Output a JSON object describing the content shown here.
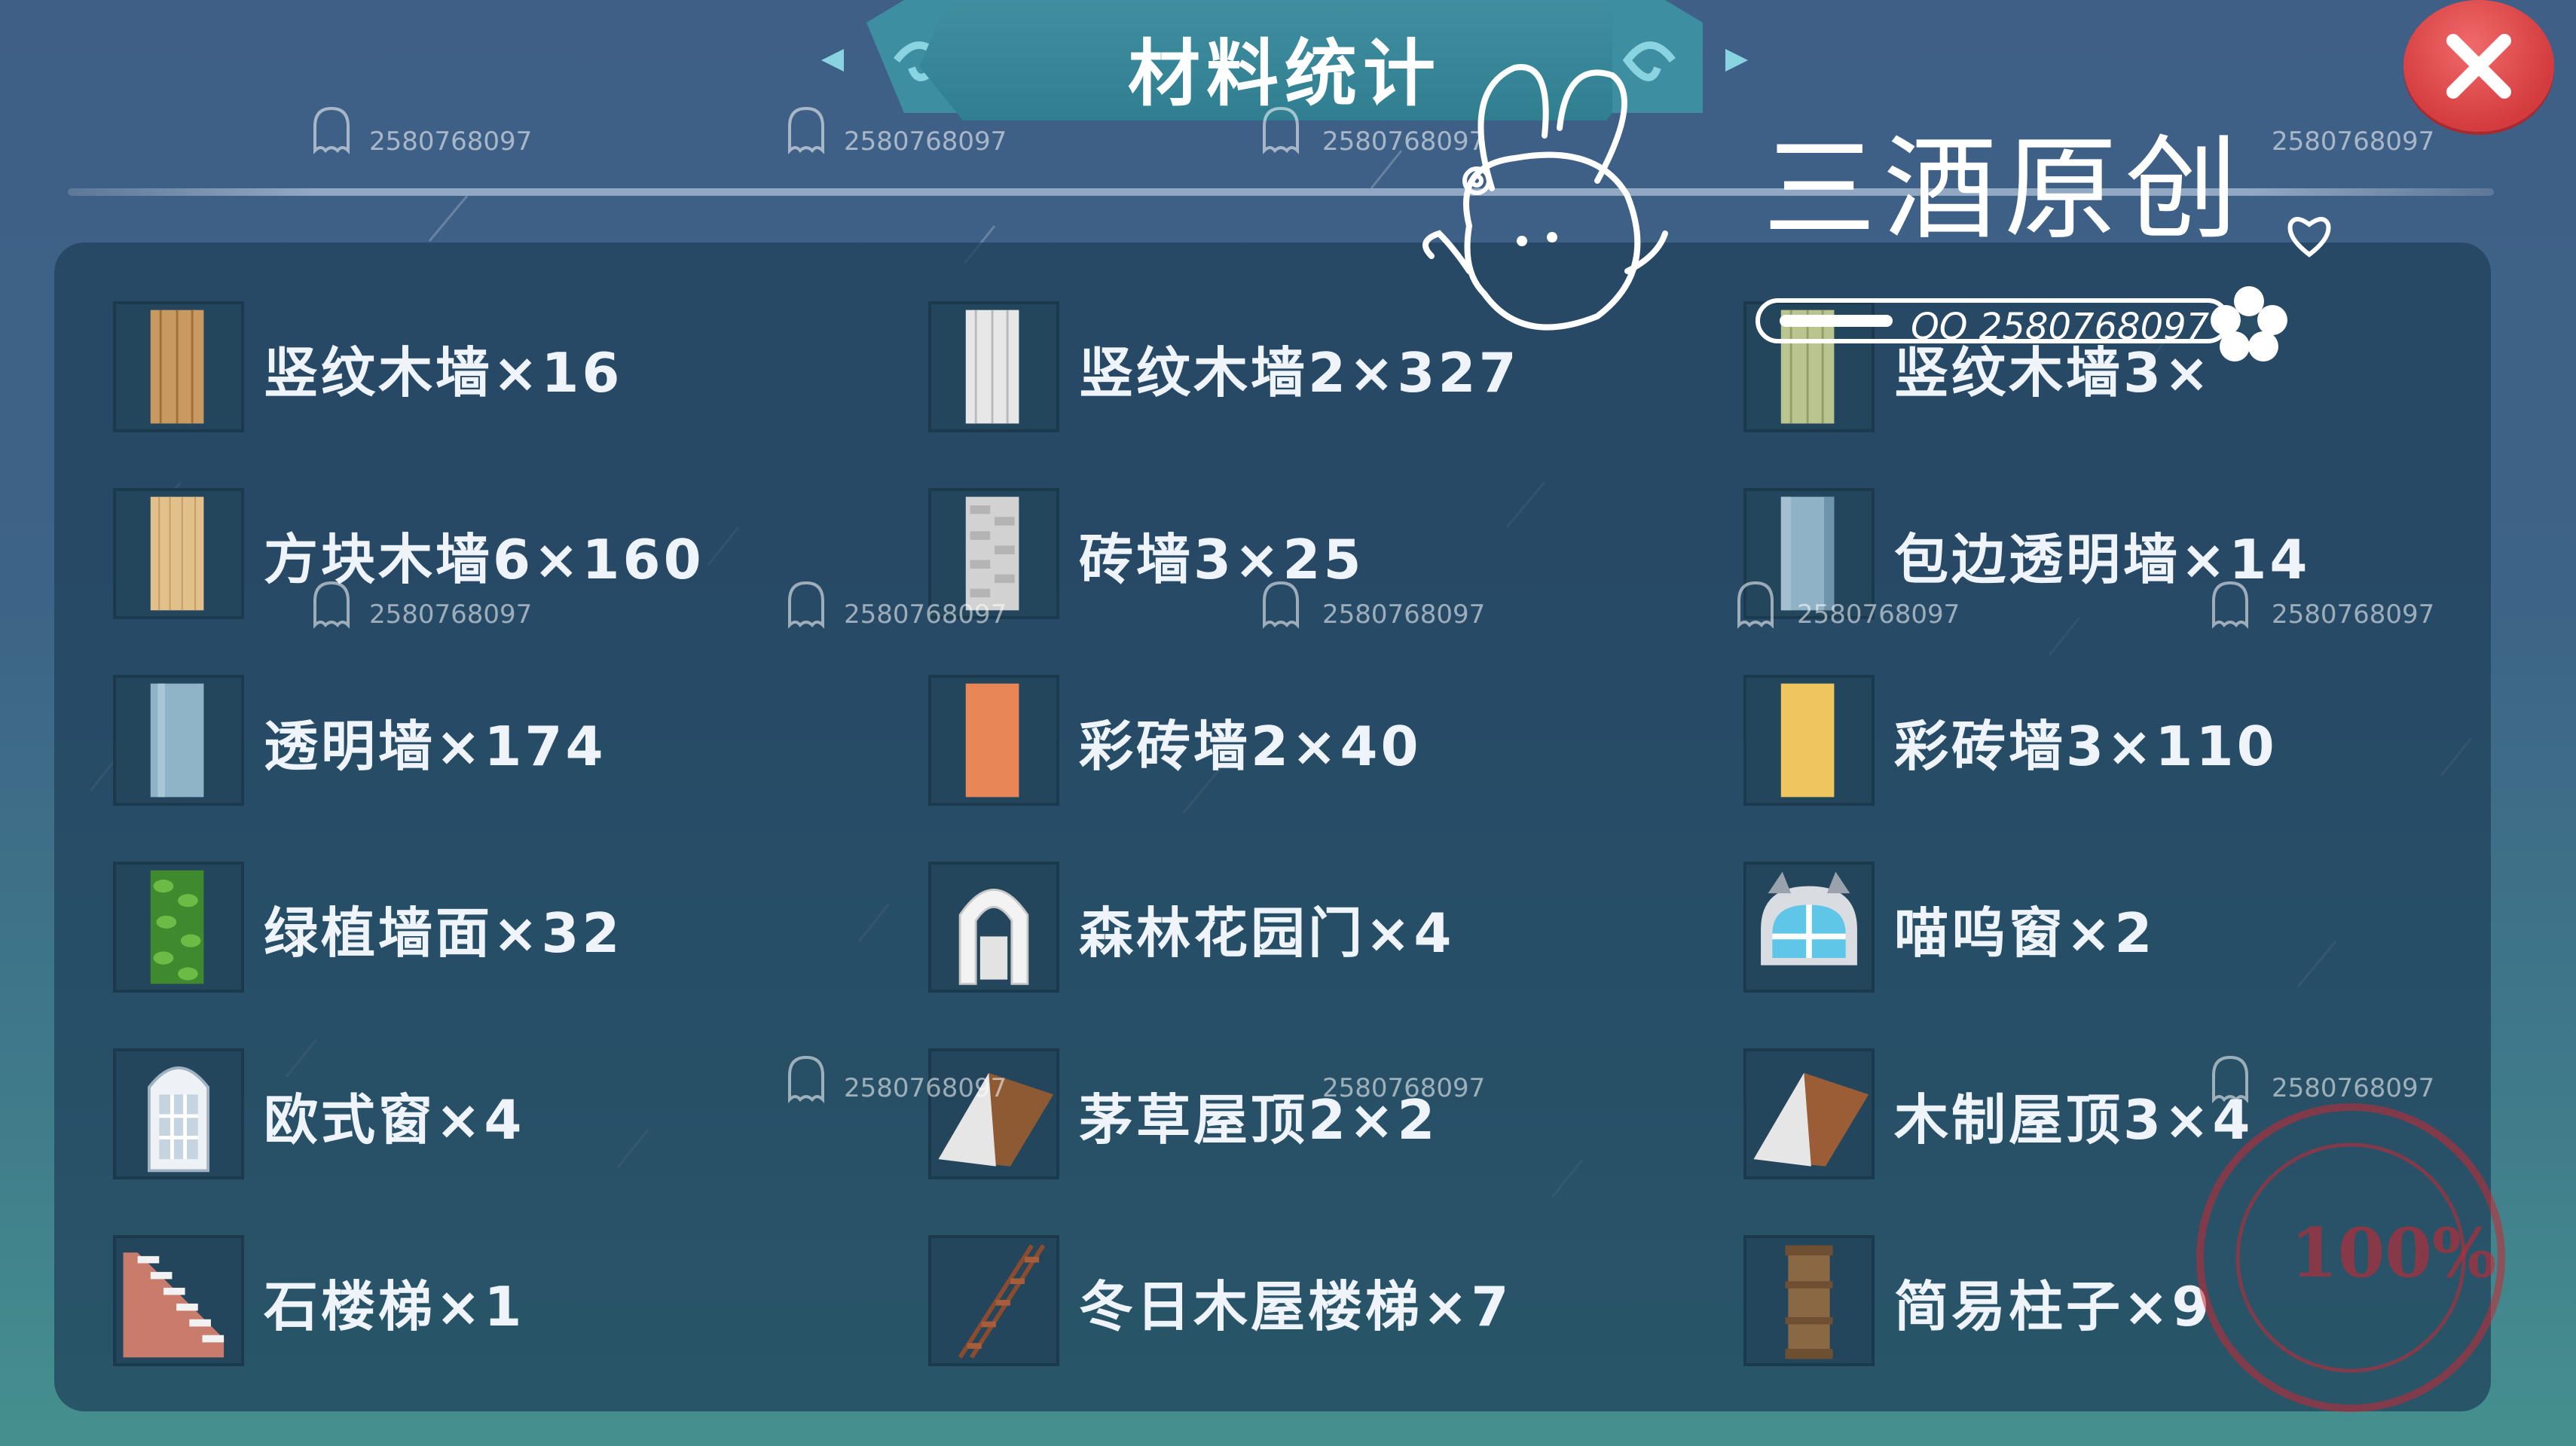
{
  "header": {
    "title": "材料统计",
    "close_icon": "close-icon"
  },
  "watermark": {
    "id": "2580768097",
    "brand": "三酒原创",
    "qq": "QQ 2580768097",
    "stamp_percent": "100%"
  },
  "materials": [
    {
      "label": "竖纹木墙×16",
      "icon": "vertical-wood-wall-icon",
      "color": "#c89a62"
    },
    {
      "label": "竖纹木墙2×327",
      "icon": "vertical-wood-wall-2-icon",
      "color": "#e7e7e7"
    },
    {
      "label": "竖纹木墙3×",
      "icon": "vertical-wood-wall-3-icon",
      "color": "#b9c48f"
    },
    {
      "label": "方块木墙6×160",
      "icon": "block-wood-wall-icon",
      "color": "#e2c08c"
    },
    {
      "label": "砖墙3×25",
      "icon": "brick-wall-icon",
      "color": "#cfcfcf"
    },
    {
      "label": "包边透明墙×14",
      "icon": "edged-glass-wall-icon",
      "color": "#8fb2c6"
    },
    {
      "label": "透明墙×174",
      "icon": "glass-wall-icon",
      "color": "#8fb4c8"
    },
    {
      "label": "彩砖墙2×40",
      "icon": "color-brick-wall-2-icon",
      "color": "#e88658"
    },
    {
      "label": "彩砖墙3×110",
      "icon": "color-brick-wall-3-icon",
      "color": "#efc55e"
    },
    {
      "label": "绿植墙面×32",
      "icon": "plant-wall-icon",
      "color": "#4f9d3a"
    },
    {
      "label": "森林花园门×4",
      "icon": "forest-garden-gate-icon",
      "color": "#ffffff"
    },
    {
      "label": "喵呜窗×2",
      "icon": "meow-window-icon",
      "color": "#5fc6e8"
    },
    {
      "label": "欧式窗×4",
      "icon": "european-window-icon",
      "color": "#f2f2f2"
    },
    {
      "label": "茅草屋顶2×2",
      "icon": "thatch-roof-icon",
      "color": "#8d5a33"
    },
    {
      "label": "木制屋顶3×4",
      "icon": "wood-roof-icon",
      "color": "#9a5d36"
    },
    {
      "label": "石楼梯×1",
      "icon": "stone-stairs-icon",
      "color": "#c97b6c"
    },
    {
      "label": "冬日木屋楼梯×7",
      "icon": "winter-cabin-stairs-icon",
      "color": "#8d4b2e"
    },
    {
      "label": "简易柱子×9",
      "icon": "simple-pillar-icon",
      "color": "#8b6844"
    }
  ]
}
